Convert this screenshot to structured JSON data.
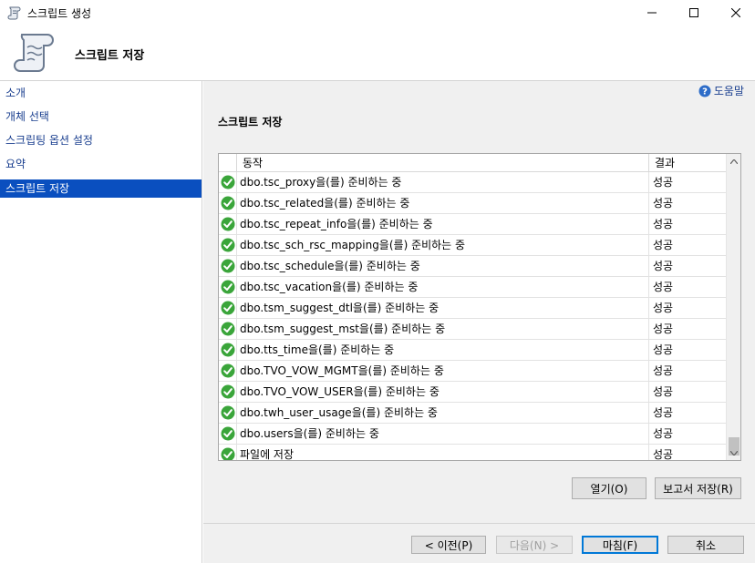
{
  "window": {
    "title": "스크립트 생성",
    "controls": [
      "minimize",
      "maximize",
      "close"
    ]
  },
  "banner": {
    "heading": "스크립트 저장",
    "icon": "scroll-icon"
  },
  "nav": {
    "items": [
      {
        "label": "소개"
      },
      {
        "label": "개체 선택"
      },
      {
        "label": "스크립팅 옵션 설정"
      },
      {
        "label": "요약"
      },
      {
        "label": "스크립트 저장"
      }
    ],
    "active_index": 4
  },
  "content": {
    "help_label": "도움말",
    "section_title": "스크립트 저장",
    "grid": {
      "columns": [
        "동작",
        "결과"
      ],
      "rows": [
        {
          "action": "dbo.tsc_proxy을(를) 준비하는 중",
          "result": "성공"
        },
        {
          "action": "dbo.tsc_related을(를) 준비하는 중",
          "result": "성공"
        },
        {
          "action": "dbo.tsc_repeat_info을(를) 준비하는 중",
          "result": "성공"
        },
        {
          "action": "dbo.tsc_sch_rsc_mapping을(를) 준비하는 중",
          "result": "성공"
        },
        {
          "action": "dbo.tsc_schedule을(를) 준비하는 중",
          "result": "성공"
        },
        {
          "action": "dbo.tsc_vacation을(를) 준비하는 중",
          "result": "성공"
        },
        {
          "action": "dbo.tsm_suggest_dtl을(를) 준비하는 중",
          "result": "성공"
        },
        {
          "action": "dbo.tsm_suggest_mst을(를) 준비하는 중",
          "result": "성공"
        },
        {
          "action": "dbo.tts_time을(를) 준비하는 중",
          "result": "성공"
        },
        {
          "action": "dbo.TVO_VOW_MGMT을(를) 준비하는 중",
          "result": "성공"
        },
        {
          "action": "dbo.TVO_VOW_USER을(를) 준비하는 중",
          "result": "성공"
        },
        {
          "action": "dbo.twh_user_usage을(를) 준비하는 중",
          "result": "성공"
        },
        {
          "action": "dbo.users을(를) 준비하는 중",
          "result": "성공"
        },
        {
          "action": "파일에 저장",
          "result": "성공"
        }
      ],
      "row_icon": "success-check-icon"
    },
    "open_button": "열기(O)",
    "save_report_button": "보고서 저장(R)"
  },
  "footer": {
    "prev_button": "< 이전(P)",
    "next_button": "다음(N) >",
    "finish_button": "마침(F)",
    "cancel_button": "취소"
  },
  "colors": {
    "nav_active_bg": "#0a4fbf",
    "nav_link": "#1a3f8f",
    "success_green": "#3aa53a",
    "content_bg": "#f0f0f0"
  }
}
